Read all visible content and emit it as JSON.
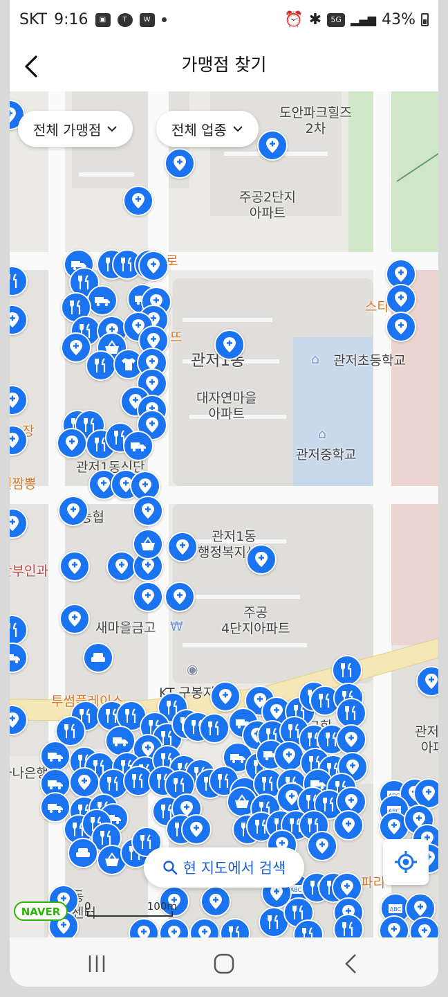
{
  "status": {
    "carrier": "SKT",
    "time": "9:16",
    "battery": "43%",
    "network": "5G"
  },
  "header": {
    "title": "가맹점 찾기"
  },
  "filters": {
    "store": "전체 가맹점",
    "category": "전체 업종"
  },
  "map_labels": {
    "doan": "도안파크힐즈\n2차",
    "jugong2": "주공2단지\n아파트",
    "gwanjeo1dong": "관저1동",
    "daejayeon": "대자연마을\n아파트",
    "gwanjeo_elem": "관저초등학교",
    "gwanjeo_mid": "관저중학교",
    "seolja": "설짬뽕",
    "jang": "장",
    "sanbu": "산부인과",
    "nonghyeop": "농협",
    "office": "관저1동\n행정복지센터",
    "jugong4": "주공\n4단지아파트",
    "saemaeul": "새마을금고",
    "ro": "로",
    "sta": "스타",
    "tteu": "뜨",
    "kt": "KT 구봉지점",
    "twosome": "투썸플레이스",
    "hana": "하나은행",
    "church": "관저교회",
    "gwanjeo_r": "관저리\n아파",
    "paris": "파리",
    "gwanjeo1dong_sub": "관저1동신단",
    "center": "센터",
    "dong": "동"
  },
  "actions": {
    "search_here": "현 지도에서 검색"
  },
  "map_meta": {
    "provider": "NAVER",
    "scale_zero": "0",
    "scale_label": "100m"
  },
  "colors": {
    "pin": "#1a73f0",
    "accent": "#1a5fd8",
    "naver": "#2db400"
  }
}
